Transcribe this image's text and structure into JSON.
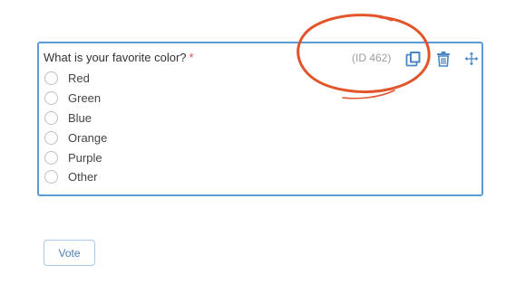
{
  "question": {
    "title": "What is your favorite color?",
    "required_marker": "*",
    "id_label": "(ID 462)",
    "options": [
      {
        "label": "Red",
        "selected": false
      },
      {
        "label": "Green",
        "selected": false
      },
      {
        "label": "Blue",
        "selected": false
      },
      {
        "label": "Orange",
        "selected": false
      },
      {
        "label": "Purple",
        "selected": false
      },
      {
        "label": "Other",
        "selected": false
      }
    ]
  },
  "toolbar": {
    "copy_icon": "copy-icon",
    "delete_icon": "trash-icon",
    "move_icon": "move-icon"
  },
  "actions": {
    "vote_label": "Vote"
  },
  "colors": {
    "card_border": "#5b9bd5",
    "accent_icon": "#4a86c5",
    "required": "#d9534f",
    "annotation_circle": "#e2552b"
  }
}
